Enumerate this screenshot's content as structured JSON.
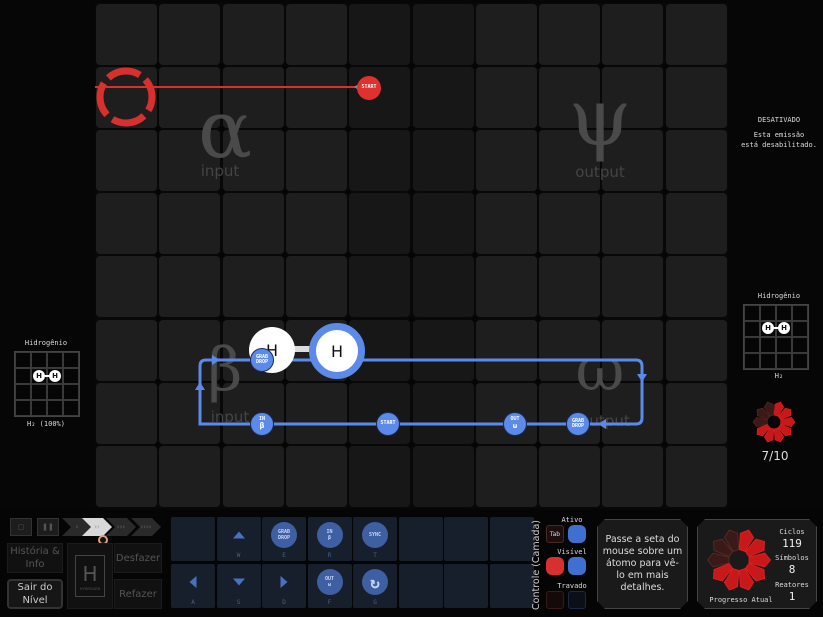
{
  "reactor": {
    "regions": {
      "alpha": {
        "glyph": "α",
        "label": "input"
      },
      "psi": {
        "glyph": "ψ",
        "label": "output"
      },
      "beta": {
        "glyph": "β",
        "label": "input"
      },
      "omega": {
        "glyph": "ω",
        "label": "output"
      }
    },
    "red_waldo": {
      "start_label": "START",
      "state": "disabled"
    },
    "blue_waldo": {
      "instructions": [
        {
          "name": "grab-drop",
          "lines": [
            "GRAB",
            "DROP"
          ]
        },
        {
          "name": "in-beta",
          "lines": [
            "IN",
            "β"
          ]
        },
        {
          "name": "start",
          "lines": [
            "START"
          ]
        },
        {
          "name": "out-omega",
          "lines": [
            "OUT",
            "ω"
          ]
        },
        {
          "name": "grab-drop-2",
          "lines": [
            "GRAB",
            "DROP"
          ]
        }
      ]
    },
    "molecule": {
      "atoms": [
        "H",
        "H"
      ]
    }
  },
  "right_panel": {
    "status_title": "DESATIVADO",
    "status_text_1": "Esta emissão",
    "status_text_2": "está desabilitado.",
    "output_title": "Hidrogênio",
    "output_formula": "H₂",
    "output_progress": "7/10",
    "output_progress_value": 0.7
  },
  "left_panel": {
    "input_title": "Hidrogênio",
    "input_formula": "H₂ (100%)"
  },
  "bottom": {
    "speed": {
      "stop": "▢",
      "pause": "❚❚",
      "step": "›",
      "play": "››",
      "fast": "›››",
      "faster": "››››"
    },
    "history_button": "História & Info",
    "exit_button": "Sair do Nível",
    "undo_button": "Desfazer",
    "redo_button": "Refazer",
    "element_symbol": "H",
    "element_name": "HYDROGEN",
    "tools": [
      {
        "key": "",
        "type": "empty"
      },
      {
        "key": "W",
        "type": "up"
      },
      {
        "key": "E",
        "type": "circle",
        "lines": [
          "GRAB",
          "DROP"
        ]
      },
      {
        "key": "R",
        "type": "circle",
        "lines": [
          "IN",
          "β"
        ]
      },
      {
        "key": "T",
        "type": "circle",
        "lines": [
          "SYNC"
        ]
      },
      {
        "key": "A",
        "type": "left"
      },
      {
        "key": "S",
        "type": "down"
      },
      {
        "key": "D",
        "type": "right"
      },
      {
        "key": "F",
        "type": "circle",
        "lines": [
          "OUT",
          "ω"
        ]
      },
      {
        "key": "G",
        "type": "rotate"
      }
    ],
    "layer_control_title": "Controle (Camada)",
    "layer_active": "Ativo",
    "layer_visible": "Visível",
    "layer_locked": "Travado",
    "layer_tab_key": "Tab",
    "info_text": "Passe a seta do mouse sobre um átomo para vê-lo em mais detalhes.",
    "progress_label": "Progresso Atual",
    "cycles_label": "Ciclos",
    "cycles_value": "119",
    "symbols_label": "Símbolos",
    "symbols_value": "8",
    "reactors_label": "Reatores",
    "reactors_value": "1",
    "progress_value": 0.7
  },
  "colors": {
    "red_waldo": "#e0312f",
    "blue_waldo": "#5b8ae8",
    "progress_on": "#c8181a",
    "progress_off": "#3a1a18"
  }
}
